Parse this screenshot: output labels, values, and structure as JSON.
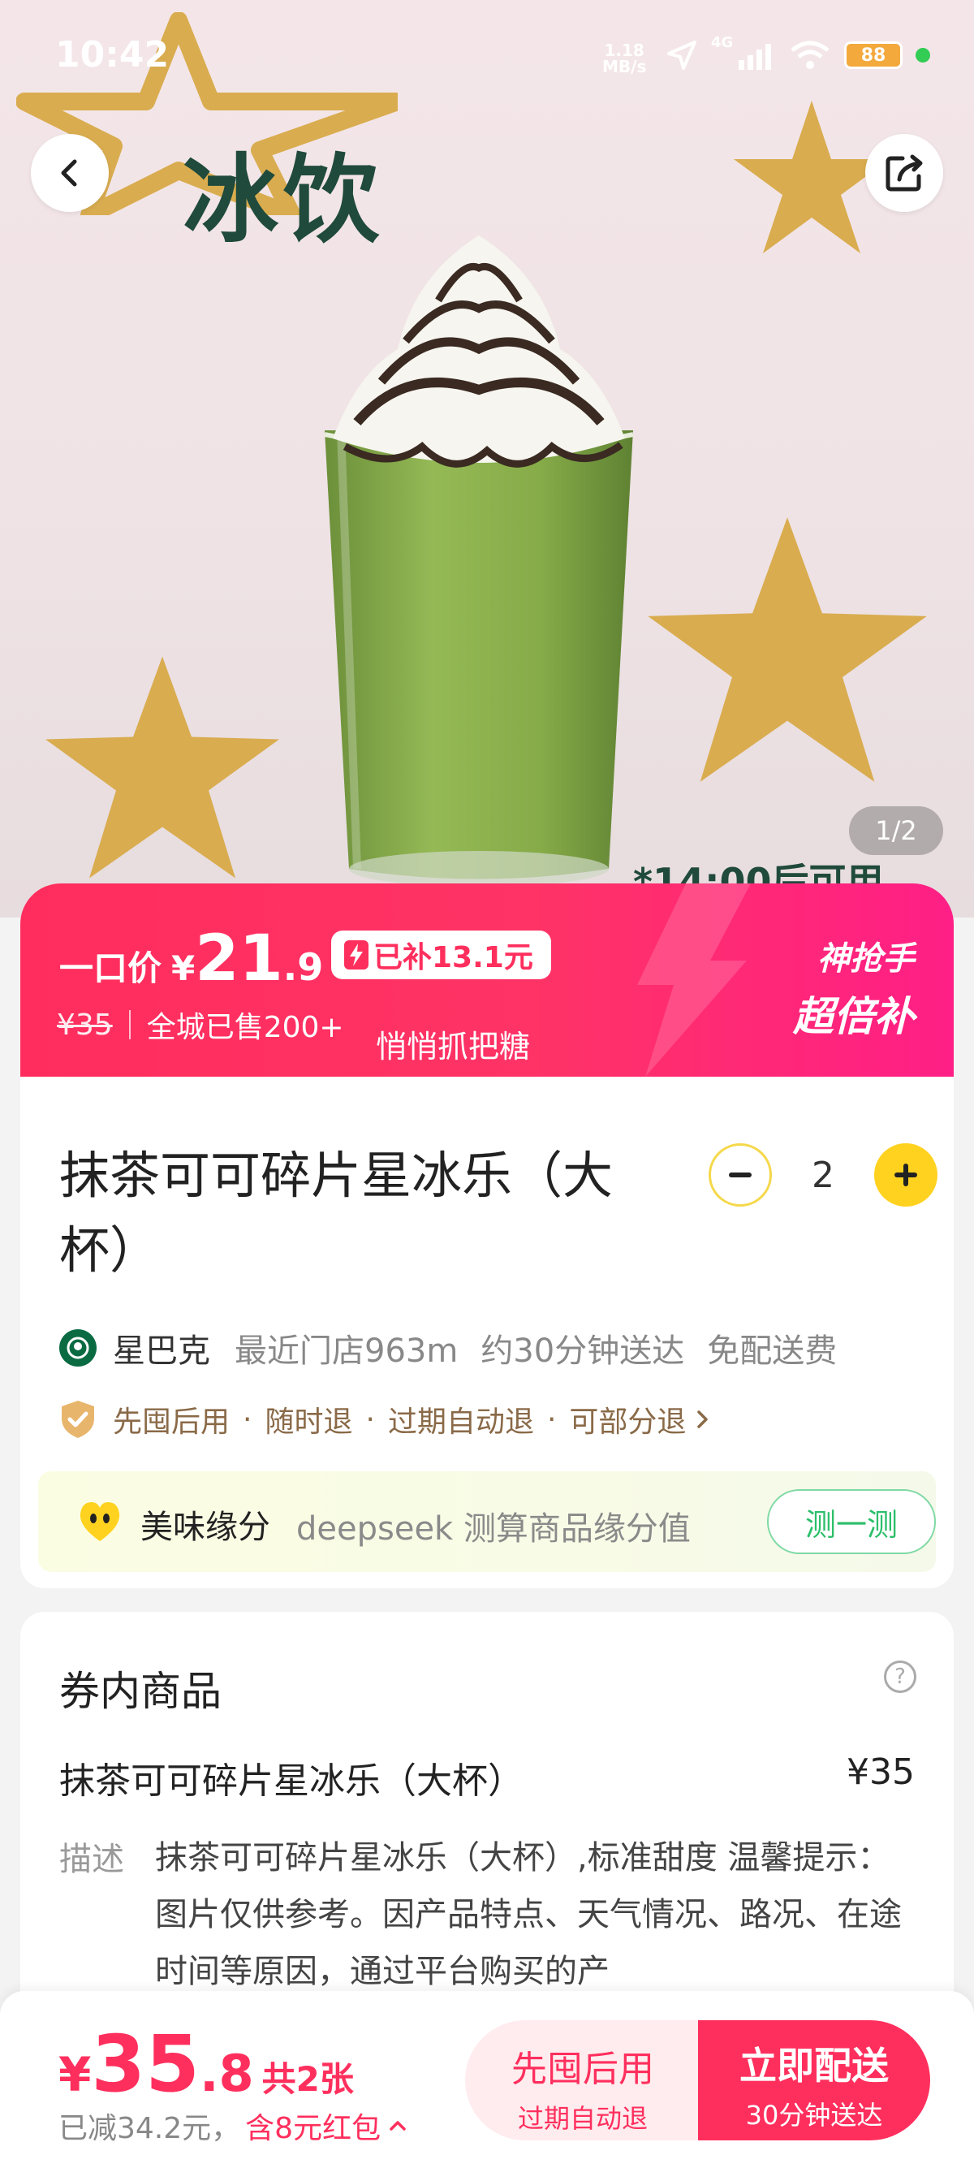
{
  "status_bar": {
    "time": "10:42",
    "net_speed": "1.18",
    "net_unit": "MB/s",
    "signal": "4G",
    "battery": "88"
  },
  "hero": {
    "title": "冰饮",
    "note": "*14:00后可用",
    "pager": "1/2"
  },
  "icons": {
    "back": "back-arrow-icon",
    "share": "share-icon"
  },
  "price_banner": {
    "label": "一口价",
    "currency": "¥",
    "price_int": "21",
    "price_dec": ".9",
    "subsidy": "已补13.1元",
    "original": "¥35",
    "sold": "全城已售200+",
    "candy": "悄悄抓把糖",
    "badge_line1": "神抢手",
    "badge_line2": "超倍补"
  },
  "product": {
    "name": "抹茶可可碎片星冰乐（大杯）",
    "quantity": "2",
    "shop": "星巴克",
    "distance": "最近门店963m",
    "delivery_time": "约30分钟送达",
    "delivery_fee": "免配送费",
    "policies": [
      "先囤后用",
      "随时退",
      "过期自动退",
      "可部分退"
    ],
    "luck_title": "美味缘分",
    "luck_desc": "deepseek 测算商品缘分值",
    "luck_button": "测一测"
  },
  "voucher": {
    "section_title": "券内商品",
    "help": "?",
    "item_name": "抹茶可可碎片星冰乐（大杯）",
    "item_price": "¥35",
    "desc_label": "描述",
    "desc_text": "抹茶可可碎片星冰乐（大杯）,标准甜度 温馨提示：图片仅供参考。因产品特点、天气情况、路况、在途时间等原因，通过平台购买的产"
  },
  "bottom_bar": {
    "currency": "¥",
    "total_int": "35",
    "total_dec": ".8",
    "count": "共2张",
    "saved": "已减34.2元，",
    "red_packet": "含8元红包",
    "btn_later": "先囤后用",
    "btn_later_sub": "过期自动退",
    "btn_deliver": "立即配送",
    "btn_deliver_sub": "30分钟送达"
  },
  "colors": {
    "accent": "#ff2f5d",
    "banner_end": "#ff1f86",
    "yellow": "#ffd21f",
    "green": "#2cbf6a",
    "star": "#d9ac4f"
  }
}
